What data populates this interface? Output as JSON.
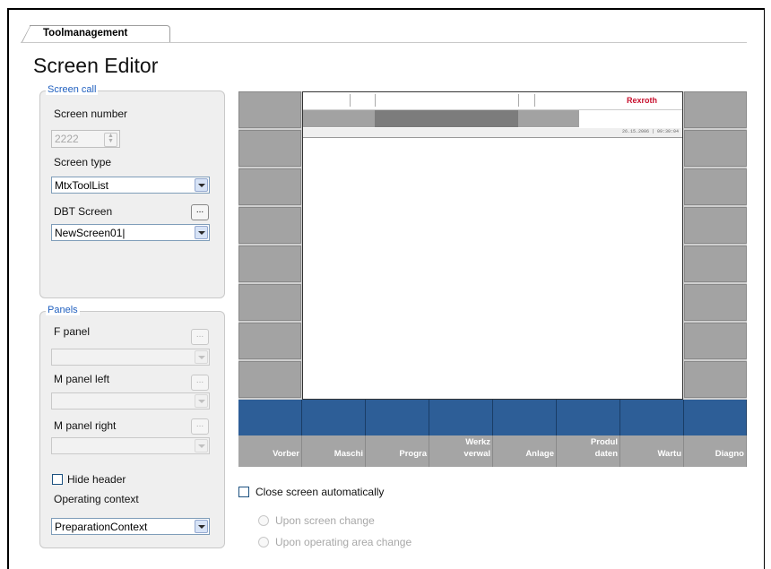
{
  "tab": {
    "label": "Toolmanagement"
  },
  "page_title": "Screen Editor",
  "screen_call": {
    "legend": "Screen call",
    "screen_number_label": "Screen number",
    "screen_number_value": "2222",
    "screen_type_label": "Screen type",
    "screen_type_value": "MtxToolList",
    "dbt_screen_label": "DBT Screen",
    "dbt_screen_value": "NewScreen01|",
    "dots": "..."
  },
  "panels": {
    "legend": "Panels",
    "f_panel_label": "F panel",
    "m_panel_left_label": "M panel left",
    "m_panel_right_label": "M panel right",
    "dots": "...",
    "hide_header_label": "Hide header",
    "operating_context_label": "Operating context",
    "operating_context_value": "PreparationContext"
  },
  "preview": {
    "brand": "Rexroth",
    "timestamp": "26.15.2006 | 09:30:04",
    "softkeys": [
      {
        "line1": "",
        "line2": "Vorber"
      },
      {
        "line1": "",
        "line2": "Maschi"
      },
      {
        "line1": "",
        "line2": "Progra"
      },
      {
        "line1": "Werkz",
        "line2": "verwal"
      },
      {
        "line1": "",
        "line2": "Anlage"
      },
      {
        "line1": "Produl",
        "line2": "daten"
      },
      {
        "line1": "",
        "line2": "Wartu"
      },
      {
        "line1": "",
        "line2": "Diagno"
      }
    ],
    "colors": {
      "softkey_blue": "#2d5e97",
      "side_grey": "#a3a3a3",
      "brand_red": "#c8102e"
    }
  },
  "close_auto": {
    "label": "Close screen automatically",
    "option1": "Upon screen change",
    "option2": "Upon operating area change"
  }
}
